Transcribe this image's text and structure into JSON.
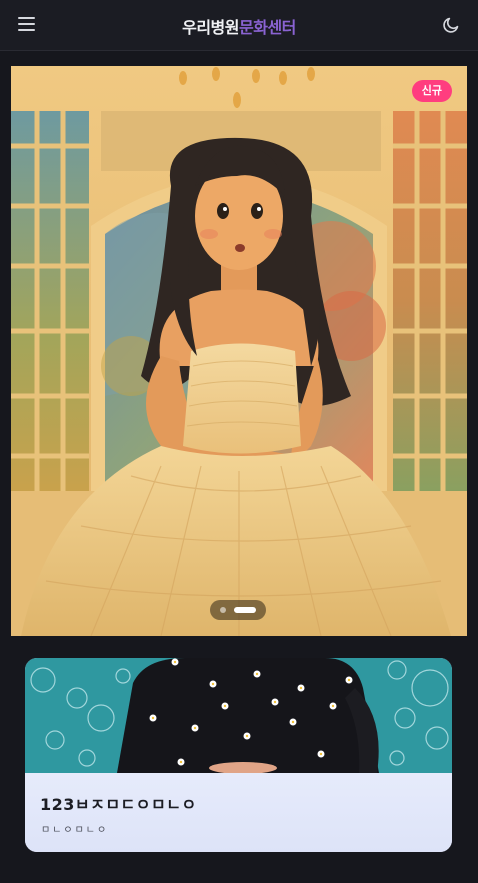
{
  "header": {
    "brand_main": "우리병원",
    "brand_accent": "문화센터",
    "menu_icon": "hamburger-menu-icon",
    "theme_icon": "moon-icon"
  },
  "hero": {
    "badge": "신규",
    "slides_total": 2,
    "active_slide": 2,
    "image": "illustration of a girl in a strapless tulle dress seated before an arched window"
  },
  "card": {
    "title": "123ㅂㅈㅁㄷㅇㅁㄴㅇ",
    "subtitle": "ㅁㄴㅇㅁㄴㅇ",
    "image": "person in black sweater with daisy pattern against teal background with bubbles"
  },
  "colors": {
    "background": "#16171d",
    "header": "#1b1c23",
    "accent": "#8a63d2",
    "badge": "#ff3d7f",
    "card": "#dfe5f9"
  }
}
